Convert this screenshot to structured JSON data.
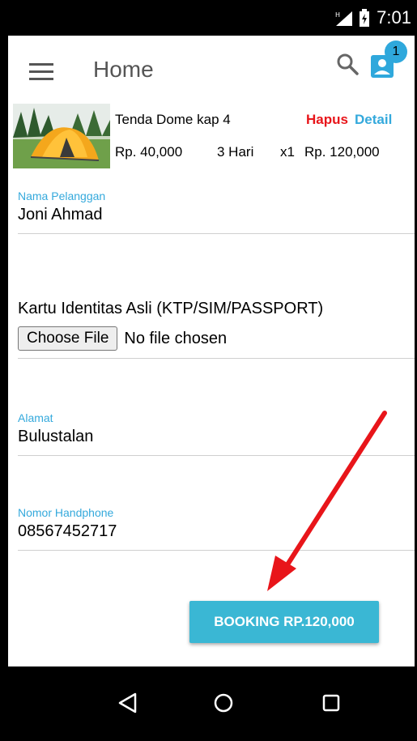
{
  "status_bar": {
    "network_badge": "H",
    "time": "7:01"
  },
  "app_bar": {
    "title": "Home",
    "cart_count": "1"
  },
  "cart_item": {
    "name": "Tenda Dome kap 4",
    "delete_label": "Hapus",
    "detail_label": "Detail",
    "price": "Rp. 40,000",
    "duration": "3 Hari",
    "quantity": "x1",
    "total": "Rp. 120,000"
  },
  "form": {
    "customer_name": {
      "label": "Nama Pelanggan",
      "value": "Joni Ahmad"
    },
    "id_card": {
      "label": "Kartu Identitas Asli (KTP/SIM/PASSPORT)",
      "button_label": "Choose File",
      "status": "No file chosen"
    },
    "address": {
      "label": "Alamat",
      "value": "Bulustalan"
    },
    "phone": {
      "label": "Nomor Handphone",
      "value": "08567452717"
    }
  },
  "booking_button": {
    "label": "BOOKING RP.120,000"
  },
  "colors": {
    "accent": "#34a9dc",
    "delete": "#e8151a",
    "button": "#3ab7d4",
    "annotation_arrow": "#e8151a"
  },
  "icons": {
    "menu": "menu-icon",
    "search": "search-icon",
    "profile": "profile-icon",
    "nav_back": "back-triangle-icon",
    "nav_home": "home-circle-icon",
    "nav_recents": "recents-square-icon"
  }
}
